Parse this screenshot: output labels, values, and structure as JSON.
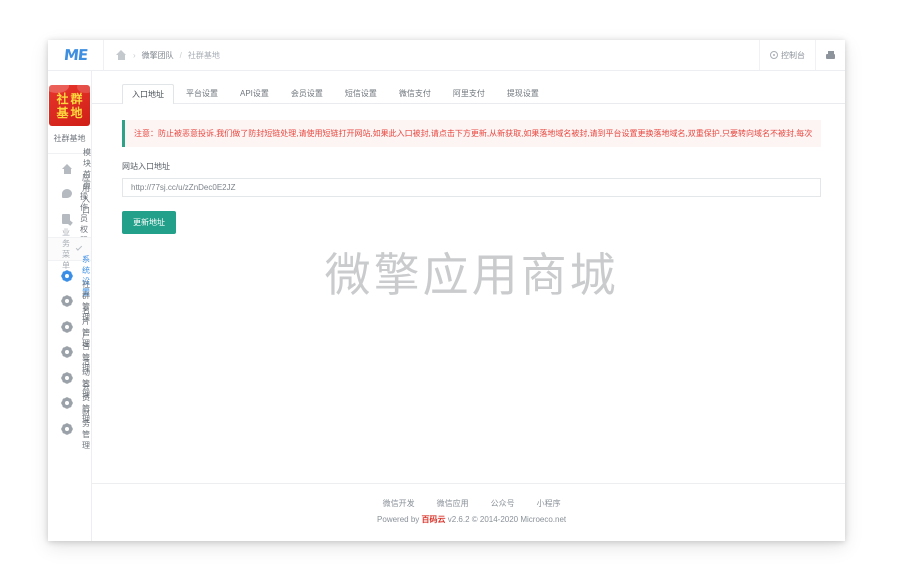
{
  "topbar": {
    "logo_text": "ME",
    "breadcrumb": {
      "home_icon": "home-icon",
      "separator": "›",
      "team": "微擎团队",
      "slash": "/",
      "current": "社群基地"
    },
    "console_label": "控制台",
    "console_icon": "gear-icon",
    "print_icon": "printer-icon"
  },
  "sidebar": {
    "brand": {
      "logo_line1": [
        "社",
        "群"
      ],
      "logo_line2": [
        "基",
        "地"
      ],
      "name": "社群基地"
    },
    "top_items": [
      {
        "label": "模块首页",
        "icon": "home-icon"
      },
      {
        "label": "应用入口",
        "icon": "chat-bubble-icon"
      },
      {
        "label": "操作员权限",
        "icon": "document-icon"
      }
    ],
    "group": {
      "label": "业务菜单",
      "chevron_icon": "chevron-down-icon"
    },
    "menu_items": [
      {
        "label": "系统设置",
        "icon": "gear-icon",
        "active": true
      },
      {
        "label": "社群管理",
        "icon": "gear-icon",
        "active": false
      },
      {
        "label": "名片管理",
        "icon": "gear-icon",
        "active": false
      },
      {
        "label": "广告管理",
        "icon": "gear-icon",
        "active": false
      },
      {
        "label": "活动管理",
        "icon": "gear-icon",
        "active": false
      },
      {
        "label": "会员管理",
        "icon": "gear-icon",
        "active": false
      },
      {
        "label": "财务管理",
        "icon": "gear-icon",
        "active": false
      }
    ]
  },
  "main": {
    "tabs": [
      {
        "label": "入口地址",
        "active": true
      },
      {
        "label": "平台设置",
        "active": false
      },
      {
        "label": "API设置",
        "active": false
      },
      {
        "label": "会员设置",
        "active": false
      },
      {
        "label": "短信设置",
        "active": false
      },
      {
        "label": "微信支付",
        "active": false
      },
      {
        "label": "阿里支付",
        "active": false
      },
      {
        "label": "提现设置",
        "active": false
      }
    ],
    "alert_text": "注意：防止被恶意投诉,我们做了防封短链处理,请使用短链打开网站,如果此入口被封,请点击下方更新,从新获取,如果落地域名被封,请到平台设置更换落地域名,双重保护,只要转向域名不被封,每次",
    "field_label": "网站入口地址",
    "field_value": "http://77sj.cc/u/zZnDec0E2JZ",
    "field_placeholder": "网站入口地址",
    "button_label": "更新地址",
    "watermark": "微擎应用商城"
  },
  "footer": {
    "links": [
      "微信开发",
      "微信应用",
      "公众号",
      "小程序"
    ],
    "powered_prefix": "Powered by ",
    "brand": "百码云",
    "powered_suffix": " v2.6.2 © 2014-2020 Microeco.net"
  },
  "colors": {
    "accent_blue": "#3a8ee6",
    "button_green": "#22a08a",
    "alert_red": "#e8483f",
    "brand_red": "#d9352c",
    "logo_red": "#cf1f16",
    "logo_gold": "#ffd83d"
  }
}
